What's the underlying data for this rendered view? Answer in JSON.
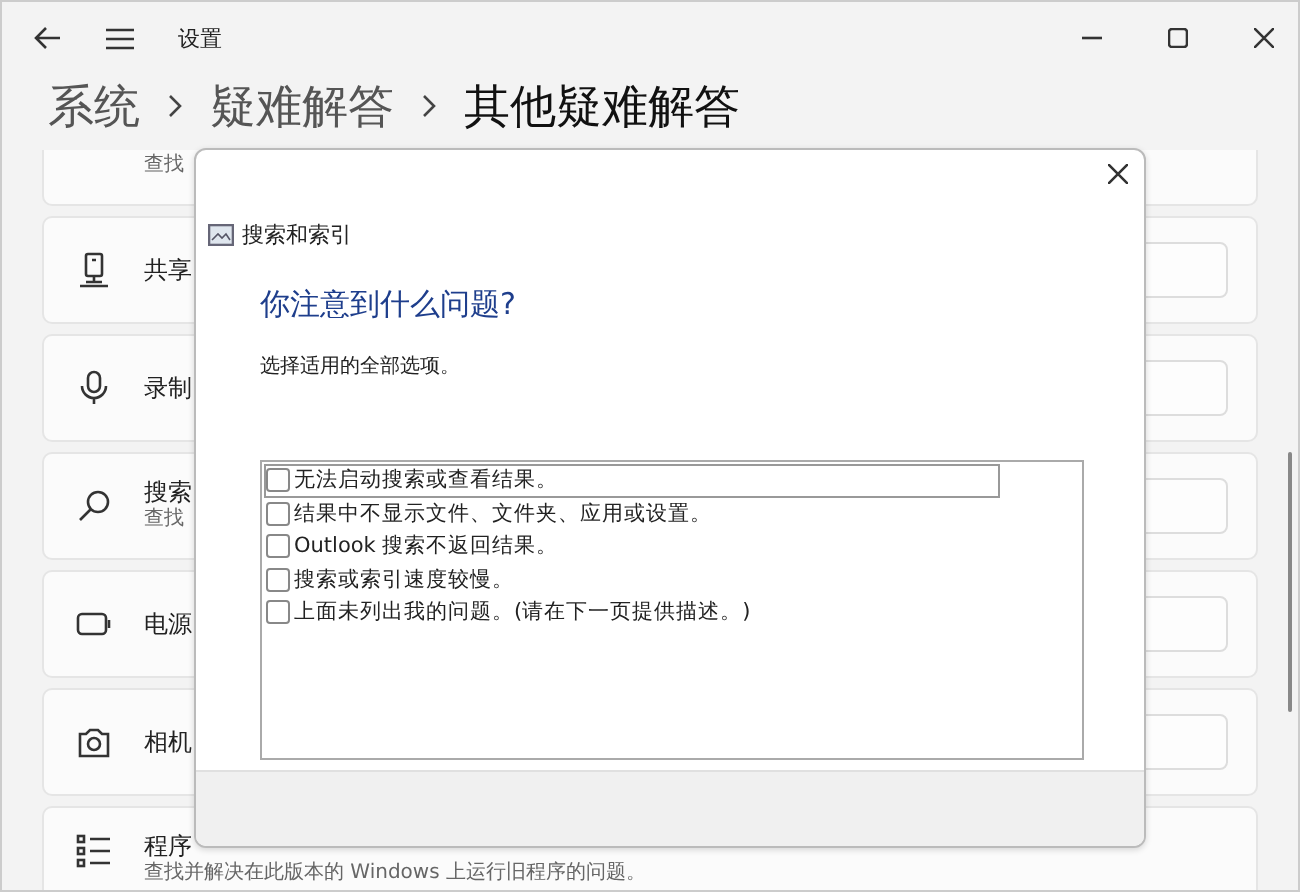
{
  "window": {
    "title": "设置",
    "breadcrumb": [
      "系统",
      "疑难解答",
      "其他疑难解答"
    ]
  },
  "cards": [
    {
      "kind": "partial",
      "subtitle": "查找"
    },
    {
      "kind": "share",
      "title": "共享"
    },
    {
      "kind": "mic",
      "title": "录制"
    },
    {
      "kind": "search",
      "title": "搜索",
      "subtitle": "查找"
    },
    {
      "kind": "battery",
      "title": "电源"
    },
    {
      "kind": "camera",
      "title": "相机"
    },
    {
      "kind": "list",
      "title": "程序",
      "subtitle": "查找并解决在此版本的 Windows 上运行旧程序的问题。"
    }
  ],
  "dialog": {
    "title": "搜索和索引",
    "heading": "你注意到什么问题?",
    "instruction": "选择适用的全部选项。",
    "options": [
      {
        "label": "无法启动搜索或查看结果。",
        "checked": false,
        "focused": true
      },
      {
        "label": "结果中不显示文件、文件夹、应用或设置。",
        "checked": false,
        "focused": false
      },
      {
        "label": "Outlook 搜索不返回结果。",
        "checked": false,
        "focused": false
      },
      {
        "label": "搜索或索引速度较慢。",
        "checked": false,
        "focused": false
      },
      {
        "label": "上面未列出我的问题。(请在下一页提供描述。)",
        "checked": false,
        "focused": false
      }
    ]
  }
}
